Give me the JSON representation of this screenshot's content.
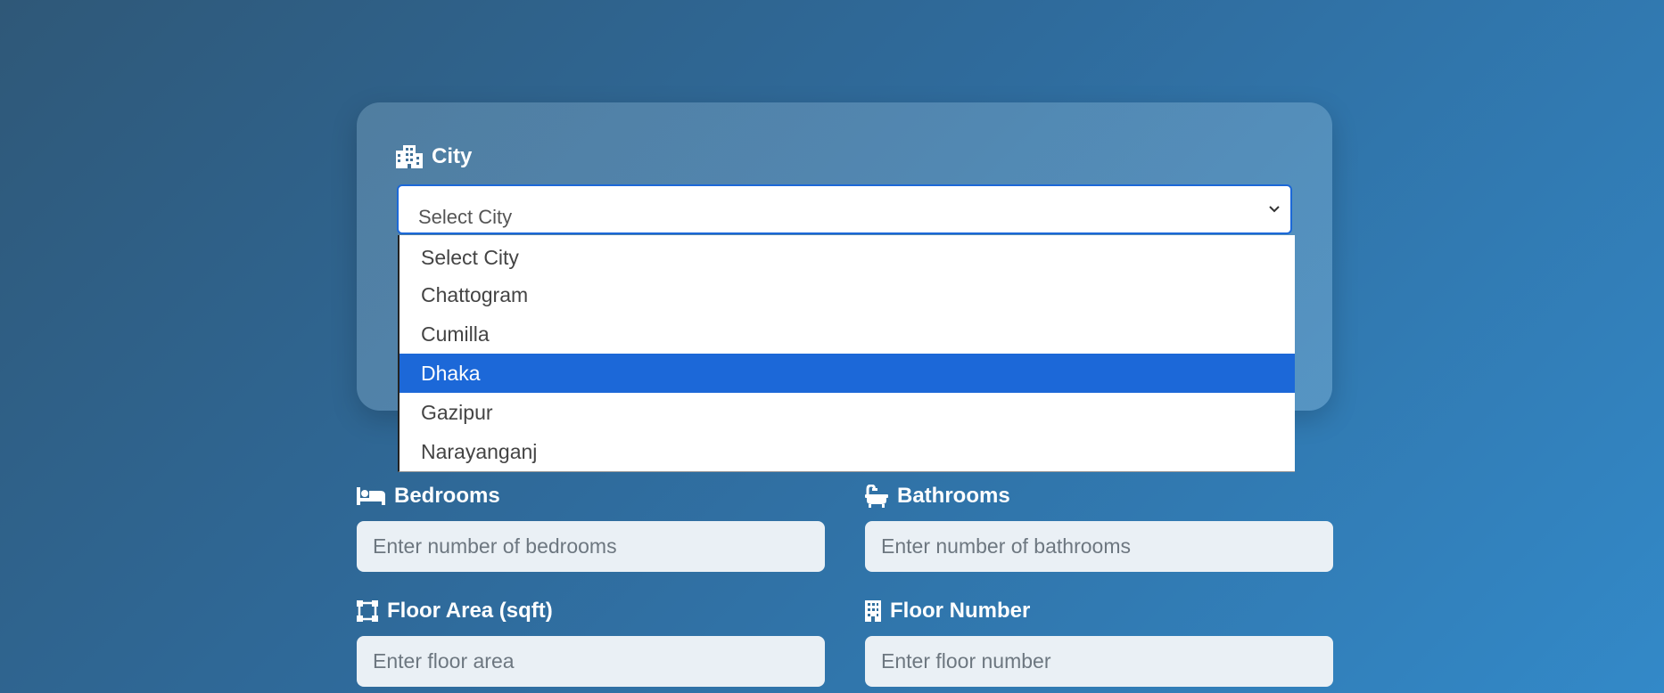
{
  "form": {
    "city": {
      "label": "City",
      "icon": "city-icon",
      "selected_text": "Select City",
      "options": [
        "Select City",
        "Chattogram",
        "Cumilla",
        "Dhaka",
        "Gazipur",
        "Narayanganj"
      ],
      "highlighted": "Dhaka"
    },
    "bedrooms": {
      "label": "Bedrooms",
      "icon": "bed-icon",
      "placeholder": "Enter number of bedrooms"
    },
    "bathrooms": {
      "label": "Bathrooms",
      "icon": "bath-icon",
      "placeholder": "Enter number of bathrooms"
    },
    "floor_area": {
      "label": "Floor Area (sqft)",
      "icon": "vector-square-icon",
      "placeholder": "Enter floor area"
    },
    "floor_number": {
      "label": "Floor Number",
      "icon": "building-icon",
      "placeholder": "Enter floor number"
    }
  },
  "colors": {
    "accent": "#1c68d8",
    "background_start": "#2f5878",
    "background_end": "#3389c8",
    "input_bg": "#eaf0f5"
  }
}
